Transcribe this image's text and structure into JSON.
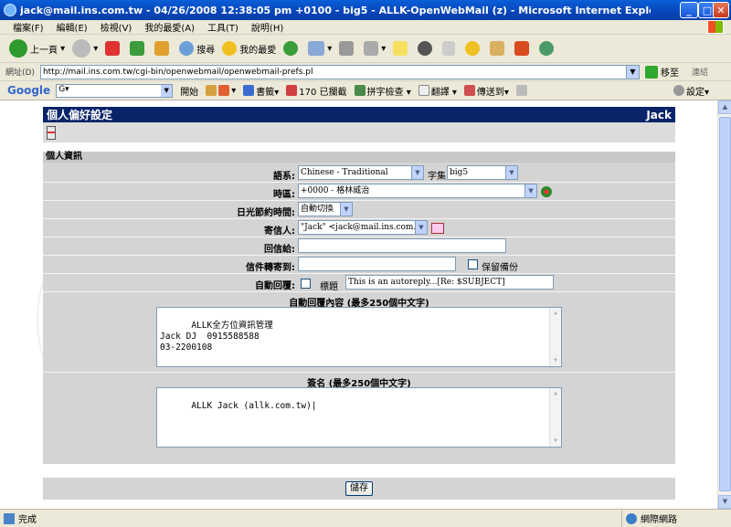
{
  "window": {
    "title": "jack@mail.ins.com.tw - 04/26/2008 12:38:05 pm +0100 - big5 - ALLK-OpenWebMail (z) - Microsoft Internet Explorer",
    "min": "_",
    "max": "□",
    "close": "✕"
  },
  "menu": [
    "檔案(F)",
    "編輯(E)",
    "檢視(V)",
    "我的最愛(A)",
    "工具(T)",
    "說明(H)"
  ],
  "toolbar": {
    "back": "上一頁",
    "search": "搜尋",
    "favorites": "我的最愛"
  },
  "address": {
    "label": "網址(D)",
    "url": "http://mail.ins.com.tw/cgi-bin/openwebmail/openwebmail-prefs.pl",
    "go": "移至",
    "links": "連結"
  },
  "google": {
    "logo": "Google",
    "search_prefix": "G▾",
    "start": "開始",
    "bookmarks": "書籤▾",
    "blocked": "170 已攔截",
    "spell": "拼字檢查 ▾",
    "translate": "翻譯 ▾",
    "send": "傳送到▾",
    "settings": "設定▾"
  },
  "page": {
    "header_title": "個人偏好設定",
    "header_user": "Jack",
    "section_title": "個人資訊",
    "language": {
      "label": "語系:",
      "value": "Chinese - Traditional",
      "charset_label": "字集",
      "charset_value": "big5"
    },
    "timezone": {
      "label": "時區:",
      "value": "+0000 - 格林威治"
    },
    "dst": {
      "label": "日光節約時間:",
      "value": "自動切換"
    },
    "from": {
      "label": "寄信人:",
      "value": "\"Jack\" <jack@mail.ins.com.tw>"
    },
    "replyto": {
      "label": "回信給:",
      "value": ""
    },
    "forward": {
      "label": "信件轉寄到:",
      "value": "",
      "keep_label": "保留備份"
    },
    "autoreply": {
      "label": "自動回覆:",
      "subject_label": "標題",
      "subject_value": "This is an autoreply...[Re: $SUBJECT]"
    },
    "autoreply_body": {
      "label": "自動回覆內容 (最多250個中文字)",
      "value": "ALLK全方位資訊管理\nJack DJ  0915588588\n03-2200108"
    },
    "signature": {
      "label": "簽名 (最多250個中文字)",
      "value": "ALLK Jack (allk.com.tw)|"
    },
    "save_label": "儲存"
  },
  "status": {
    "left": "完成",
    "right": "網際網路"
  }
}
